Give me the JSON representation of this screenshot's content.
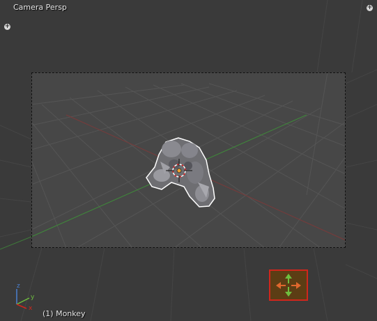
{
  "viewport": {
    "view_title": "Camera Persp",
    "object_info": "(1) Monkey",
    "toolshelf_toggle": "+",
    "properties_toggle": "+"
  },
  "axis_gizmo": {
    "x_label": "x",
    "y_label": "y",
    "z_label": "z"
  },
  "colors": {
    "background": "#393939",
    "passepartout": "#3a3a3a",
    "camera_view": "#474747",
    "grid_line": "#525252",
    "x_axis_line": "#8a3a3a",
    "y_axis_line": "#3f8a3a",
    "gizmo_border": "#d0261c",
    "gizmo_fill": "#5c3d14",
    "gizmo_arrow_up_down": "#6fbf3f",
    "gizmo_arrow_left_right": "#e0672d"
  },
  "icons": {
    "navigate_gizmo": "move-arrows-icon",
    "toolshelf_toggle": "plus-icon",
    "properties_toggle": "plus-icon",
    "cursor_3d": "crosshair-icon",
    "origin": "origin-dot-icon"
  }
}
